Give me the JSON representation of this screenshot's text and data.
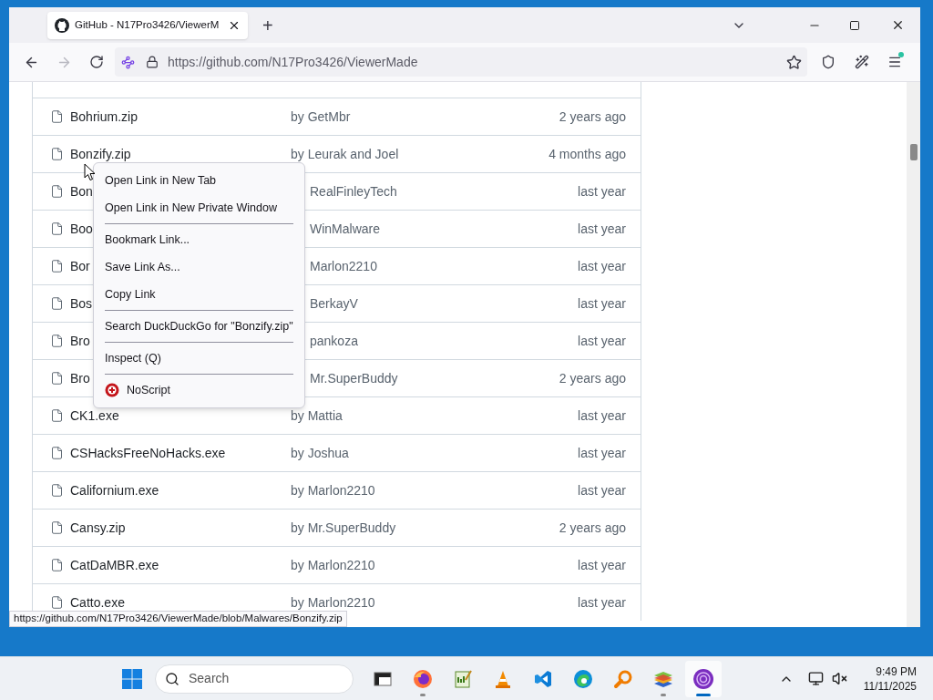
{
  "browser": {
    "tab": {
      "title": "GitHub - N17Pro3426/ViewerM",
      "selected": true
    },
    "new_tab": "+",
    "url": "https://github.com/N17Pro3426/ViewerMade",
    "forward_disabled": true,
    "menu_notification": true
  },
  "files": [
    {
      "kind": "full",
      "name": "Bohrium.zip",
      "author": "by GetMbr",
      "updated": "2 years ago"
    },
    {
      "kind": "full",
      "name": "Bonzify.zip",
      "author": "by Leurak and Joel",
      "updated": "4 months ago"
    },
    {
      "kind": "covered",
      "name": "Bon",
      "author": "RealFinleyTech",
      "updated": "last year"
    },
    {
      "kind": "covered",
      "name": "Boo",
      "author": "WinMalware",
      "updated": "last year"
    },
    {
      "kind": "covered",
      "name": "Bor",
      "author": "Marlon2210",
      "updated": "last year"
    },
    {
      "kind": "covered",
      "name": "Bos",
      "author": "BerkayV",
      "updated": "last year"
    },
    {
      "kind": "covered",
      "name": "Bro",
      "author": "pankoza",
      "updated": "last year"
    },
    {
      "kind": "covered",
      "name": "Bro",
      "author": "Mr.SuperBuddy",
      "updated": "2 years ago"
    },
    {
      "kind": "full",
      "name": "CK1.exe",
      "author": "by Mattia",
      "updated": "last year"
    },
    {
      "kind": "full",
      "name": "CSHacksFreeNoHacks.exe",
      "author": "by Joshua",
      "updated": "last year"
    },
    {
      "kind": "full",
      "name": "Californium.exe",
      "author": "by Marlon2210",
      "updated": "last year"
    },
    {
      "kind": "full",
      "name": "Cansy.zip",
      "author": "by Mr.SuperBuddy",
      "updated": "2 years ago"
    },
    {
      "kind": "full",
      "name": "CatDaMBR.exe",
      "author": "by Marlon2210",
      "updated": "last year"
    },
    {
      "kind": "full",
      "name": "Catto.exe",
      "author": "by Marlon2210",
      "updated": "last year"
    }
  ],
  "context_menu": {
    "items": [
      {
        "kind": "item",
        "label": "Open Link in New Tab"
      },
      {
        "kind": "item",
        "label": "Open Link in New Private Window"
      },
      {
        "kind": "separator"
      },
      {
        "kind": "item",
        "label": "Bookmark Link..."
      },
      {
        "kind": "item",
        "label": "Save Link As..."
      },
      {
        "kind": "item",
        "label": "Copy Link"
      },
      {
        "kind": "separator"
      },
      {
        "kind": "item",
        "label": "Search DuckDuckGo for \"Bonzify.zip\""
      },
      {
        "kind": "separator"
      },
      {
        "kind": "item",
        "label": "Inspect (Q)"
      },
      {
        "kind": "separator"
      },
      {
        "kind": "extension",
        "label": "NoScript"
      }
    ]
  },
  "status_link": "https://github.com/N17Pro3426/ViewerMade/blob/Malwares/Bonzify.zip",
  "taskbar": {
    "search": {
      "placeholder": "Search"
    },
    "apps": [
      {
        "kind": "terminal",
        "running": false,
        "active": false
      },
      {
        "kind": "firefox",
        "running": true,
        "active": false
      },
      {
        "kind": "notepad",
        "running": false,
        "active": false
      },
      {
        "kind": "cone",
        "running": false,
        "active": false
      },
      {
        "kind": "code",
        "running": false,
        "active": false
      },
      {
        "kind": "edge",
        "running": false,
        "active": false
      },
      {
        "kind": "magnifier",
        "running": false,
        "active": false
      },
      {
        "kind": "stack",
        "running": true,
        "active": false
      },
      {
        "kind": "orb",
        "running": true,
        "active": true
      }
    ],
    "clock": {
      "time": "9:49 PM",
      "date": "11/11/2025"
    }
  }
}
